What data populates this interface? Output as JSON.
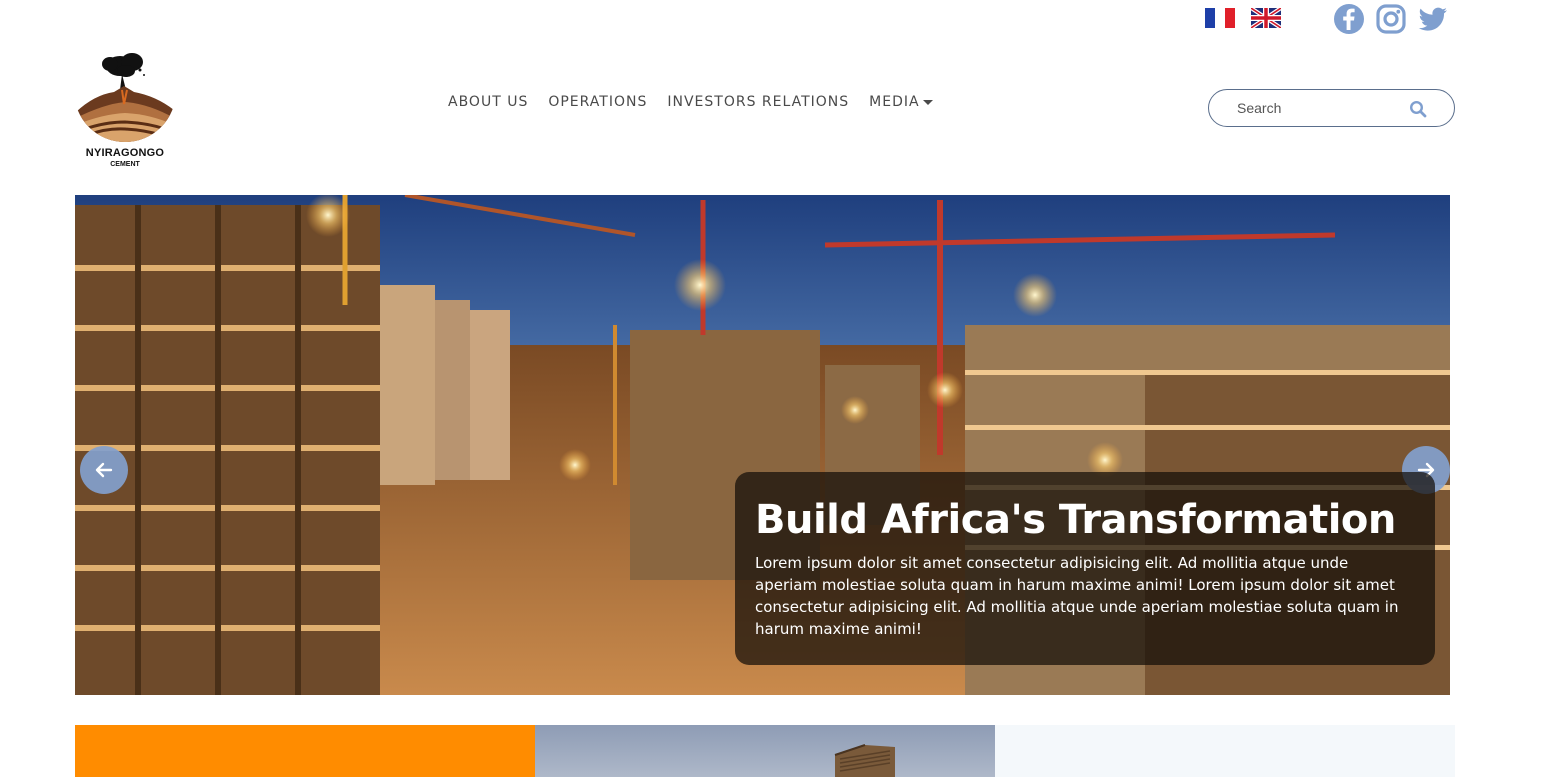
{
  "languages": [
    {
      "code": "fr",
      "icon": "french-flag-icon"
    },
    {
      "code": "en",
      "icon": "uk-flag-icon"
    }
  ],
  "socials": [
    {
      "name": "facebook",
      "icon": "facebook-icon",
      "color": "#7f9fcf"
    },
    {
      "name": "instagram",
      "icon": "instagram-icon",
      "color": "#7f9fcf"
    },
    {
      "name": "twitter",
      "icon": "twitter-icon",
      "color": "#7f9fcf"
    }
  ],
  "logo": {
    "name": "NYIRAGONGO",
    "sub": "CEMENT"
  },
  "nav": {
    "items": [
      {
        "label": "ABOUT US"
      },
      {
        "label": "OPERATIONS"
      },
      {
        "label": "INVESTORS RELATIONS"
      },
      {
        "label": "MEDIA"
      }
    ]
  },
  "search": {
    "placeholder": "Search",
    "icon": "search-icon"
  },
  "hero": {
    "title": "Build Africa's Transformation",
    "text": "Lorem ipsum dolor sit amet consectetur adipisicing elit. Ad mollitia atque unde aperiam molestiae soluta quam in harum maxime animi! Lorem ipsum dolor sit amet consectetur adipisicing elit. Ad mollitia atque unde aperiam molestiae soluta quam in harum maxime animi!",
    "prev_icon": "arrow-left-icon",
    "next_icon": "arrow-right-icon"
  },
  "colors": {
    "accent": "#7f9fcf",
    "orange": "#ff8c00",
    "nav_text": "#4a4a4a"
  }
}
